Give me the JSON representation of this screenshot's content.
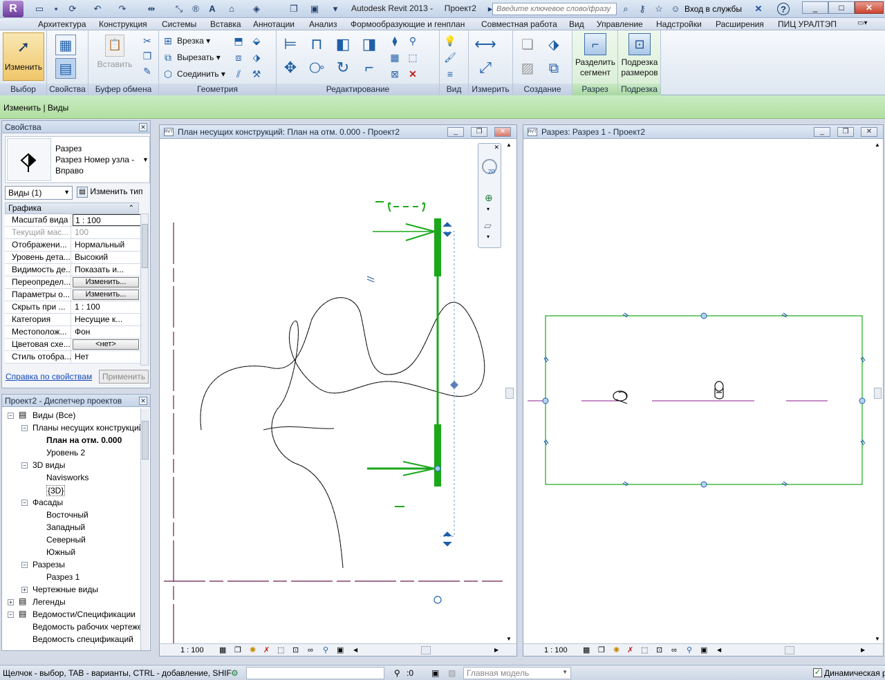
{
  "titlebar": {
    "app_title": "Autodesk Revit 2013 -",
    "project": "Проект2",
    "search_placeholder": "Введите ключевое слово/фразу",
    "signin": "Вход в службы",
    "help": "?"
  },
  "menu": [
    "Архитектура",
    "Конструкция",
    "Системы",
    "Вставка",
    "Аннотации",
    "Анализ",
    "Формообразующие и генплан",
    "Совместная работа",
    "Вид",
    "Управление",
    "Надстройки",
    "Расширения",
    "ПИЦ УРАЛТЭП"
  ],
  "ribbon": {
    "modify_label": "Изменить",
    "paste_label": "Вставить",
    "cope_label": "Врезка",
    "cut_label": "Вырезать",
    "join_label": "Соединить",
    "split_segment_label": "Разделить сегмент",
    "crop_dims_label": "Подрезка размеров",
    "panels": {
      "select": "Выбор",
      "properties": "Свойства",
      "clipboard": "Буфер обмена",
      "geometry": "Геометрия",
      "modify": "Редактирование",
      "view": "Вид",
      "measure": "Измерить",
      "create": "Создание",
      "section": "Разрез",
      "crop": "Подрезка"
    }
  },
  "context_bar": "Изменить | Виды",
  "properties": {
    "title": "Свойства",
    "type_name_1": "Разрез",
    "type_name_2": "Разрез Номер узла -",
    "type_name_3": "Вправо",
    "selector": "Виды (1)",
    "edit_type": "Изменить тип",
    "group": "Графика",
    "rows": [
      {
        "k": "Масштаб вида",
        "v": "1 : 100",
        "kind": "input"
      },
      {
        "k": "Текущий мас...",
        "v": "100",
        "kind": "grey"
      },
      {
        "k": "Отображени...",
        "v": "Нормальный",
        "kind": "text"
      },
      {
        "k": "Уровень дета...",
        "v": "Высокий",
        "kind": "text"
      },
      {
        "k": "Видимость де...",
        "v": "Показать и...",
        "kind": "text"
      },
      {
        "k": "Переопредел...",
        "v": "Изменить...",
        "kind": "button"
      },
      {
        "k": "Параметры о...",
        "v": "Изменить...",
        "kind": "button"
      },
      {
        "k": "Скрыть при ...",
        "v": "1 : 100",
        "kind": "text"
      },
      {
        "k": "Категория",
        "v": "Несущие к...",
        "kind": "text"
      },
      {
        "k": "Местополож...",
        "v": "Фон",
        "kind": "text"
      },
      {
        "k": "Цветовая схе...",
        "v": "<нет>",
        "kind": "button"
      },
      {
        "k": "Стиль отобра...",
        "v": "Нет",
        "kind": "text"
      }
    ],
    "help_link": "Справка по свойствам",
    "apply": "Применить"
  },
  "browser": {
    "title": "Проект2 - Диспетчер проектов",
    "nodes": [
      {
        "label": "Виды (Все)",
        "depth": 0,
        "toggle": "−",
        "bold": false
      },
      {
        "label": "Планы несущих конструкций",
        "depth": 1,
        "toggle": "−",
        "bold": false
      },
      {
        "label": "План на отм. 0.000",
        "depth": 2,
        "toggle": "",
        "bold": true
      },
      {
        "label": "Уровень 2",
        "depth": 2,
        "toggle": "",
        "bold": false
      },
      {
        "label": "3D виды",
        "depth": 1,
        "toggle": "−",
        "bold": false
      },
      {
        "label": "Navisworks",
        "depth": 2,
        "toggle": "",
        "bold": false
      },
      {
        "label": "{3D}",
        "depth": 2,
        "toggle": "",
        "bold": false
      },
      {
        "label": "Фасады",
        "depth": 1,
        "toggle": "−",
        "bold": false
      },
      {
        "label": "Восточный",
        "depth": 2,
        "toggle": "",
        "bold": false
      },
      {
        "label": "Западный",
        "depth": 2,
        "toggle": "",
        "bold": false
      },
      {
        "label": "Северный",
        "depth": 2,
        "toggle": "",
        "bold": false
      },
      {
        "label": "Южный",
        "depth": 2,
        "toggle": "",
        "bold": false
      },
      {
        "label": "Разрезы",
        "depth": 1,
        "toggle": "−",
        "bold": false
      },
      {
        "label": "Разрез 1",
        "depth": 2,
        "toggle": "",
        "bold": false
      },
      {
        "label": "Чертежные виды",
        "depth": 1,
        "toggle": "+",
        "bold": false
      },
      {
        "label": "Легенды",
        "depth": 0,
        "toggle": "+",
        "bold": false
      },
      {
        "label": "Ведомости/Спецификации",
        "depth": 0,
        "toggle": "−",
        "bold": false
      },
      {
        "label": "Ведомость рабочих чертежей",
        "depth": 1,
        "toggle": "",
        "bold": false
      },
      {
        "label": "Ведомость спецификаций",
        "depth": 1,
        "toggle": "",
        "bold": false
      }
    ]
  },
  "plan_view": {
    "title": "План несущих конструкций: План на отм. 0.000 - Проект2",
    "scale": "1 : 100",
    "nav_2d": "2D"
  },
  "section_view": {
    "title": "Разрез: Разрез 1 - Проект2",
    "scale": "1 : 100"
  },
  "status": {
    "hint": "Щелчок - выбор, TAB - варианты, CTRL - добавление, SHIF",
    "count": ":0",
    "model": "Главная модель",
    "dynamic": "Динамическая р"
  },
  "colors": {
    "section_green": "#1aa81a",
    "grid_purple": "#6b1a4a",
    "accent": "#1f5fa8"
  }
}
